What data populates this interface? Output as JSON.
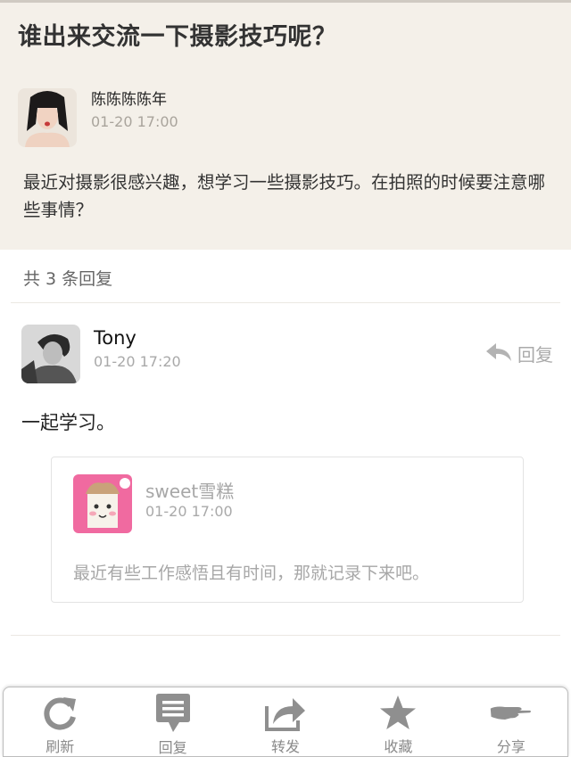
{
  "post": {
    "title": "谁出来交流一下摄影技巧呢？",
    "author": "陈陈陈陈年",
    "time": "01-20 17:00",
    "body": "最近对摄影很感兴趣，想学习一些摄影技巧。在拍照的时候要注意哪些事情？"
  },
  "replies_header": "共 3 条回复",
  "reply": {
    "author": "Tony",
    "time": "01-20 17:20",
    "reply_label": "回复",
    "content": "一起学习。",
    "quote": {
      "author": "sweet雪糕",
      "time": "01-20 17:00",
      "text": "最近有些工作感悟且有时间，那就记录下来吧。"
    }
  },
  "toolbar": [
    {
      "label": "刷新",
      "icon": "refresh-icon"
    },
    {
      "label": "回复",
      "icon": "comment-icon"
    },
    {
      "label": "转发",
      "icon": "forward-icon"
    },
    {
      "label": "收藏",
      "icon": "star-icon"
    },
    {
      "label": "分享",
      "icon": "share-hand-icon"
    }
  ],
  "colors": {
    "post_background": "#f4f0e9",
    "icon_gray": "#8f8f8f",
    "muted_text": "#a9a9a9"
  }
}
